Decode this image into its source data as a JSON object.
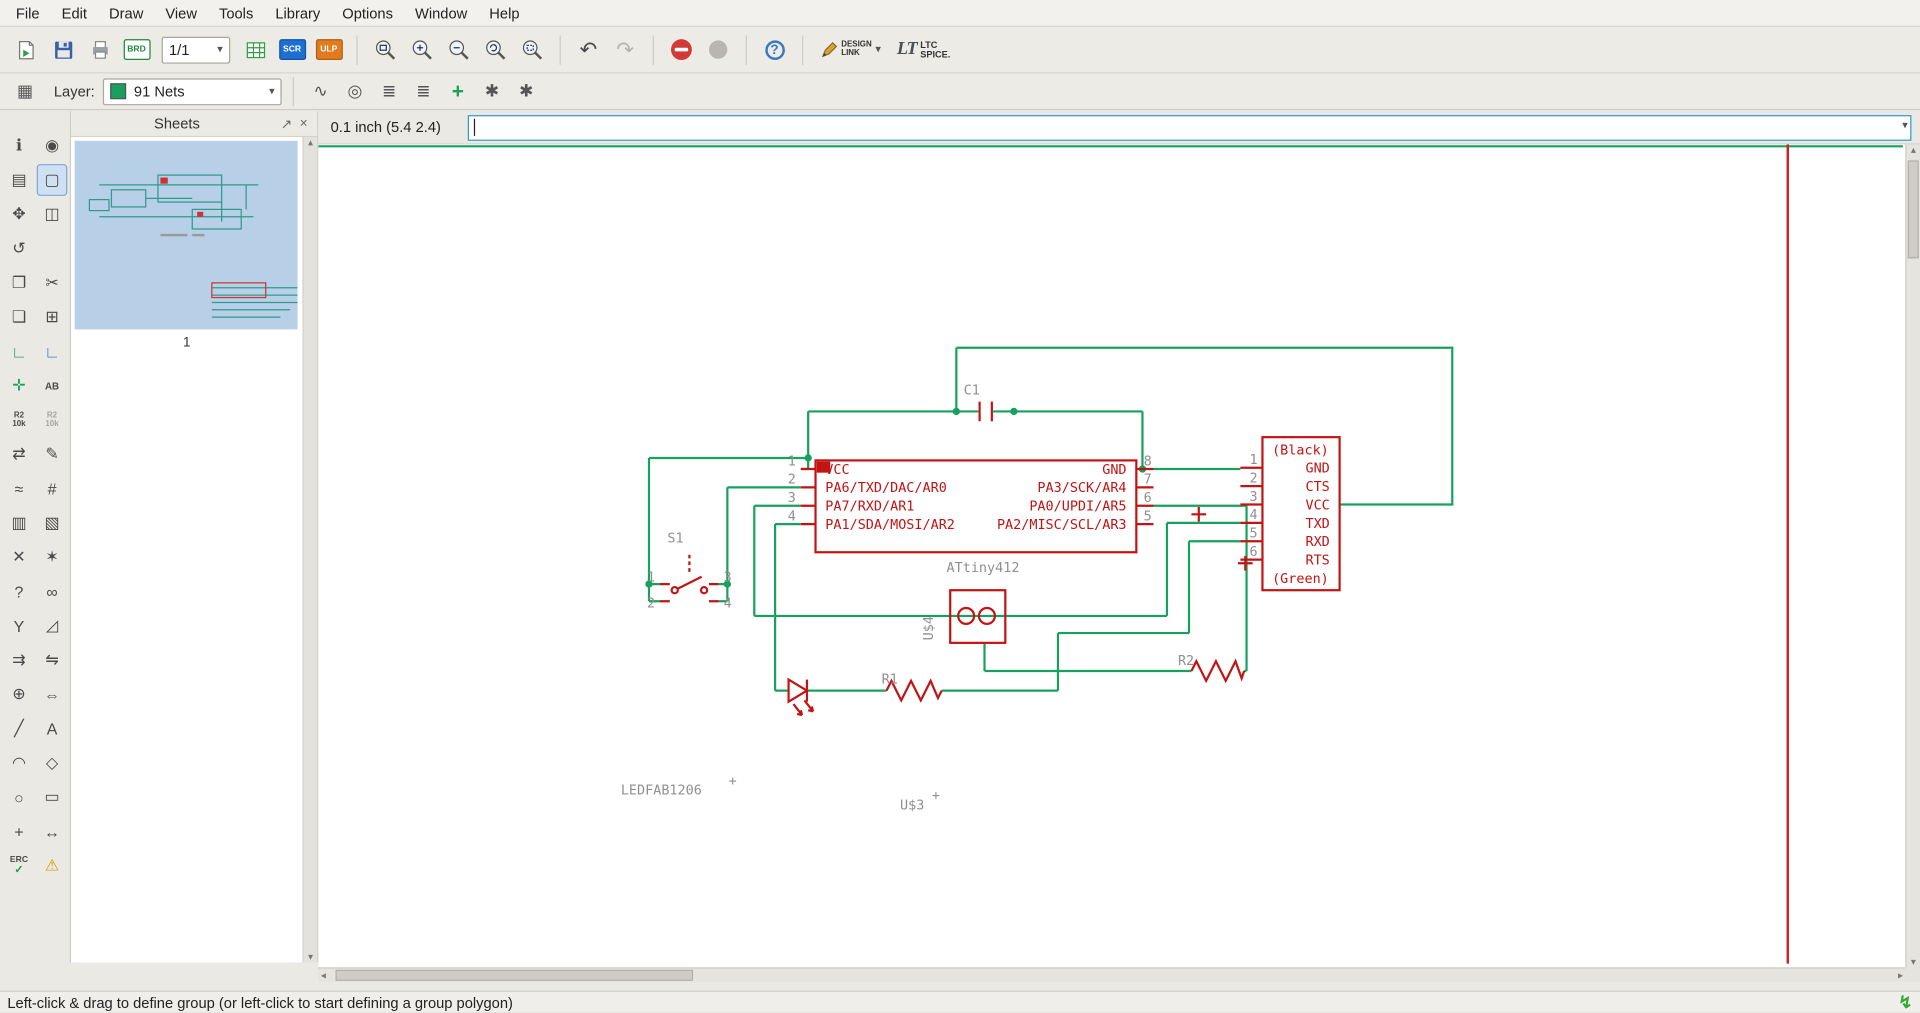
{
  "menubar": {
    "items": [
      "File",
      "Edit",
      "Draw",
      "View",
      "Tools",
      "Library",
      "Options",
      "Window",
      "Help"
    ]
  },
  "toolbar": {
    "page_indicator": "1/1",
    "brd_label": "BRD",
    "scr_label": "SCR",
    "ulp_label": "ULP",
    "design_link_line1": "DESIGN",
    "design_link_line2": "LINK",
    "ltc_logo": "LT",
    "ltc_line1": "LTC",
    "ltc_line2": "SPICE."
  },
  "layerbar": {
    "label": "Layer:",
    "selected_layer": "91 Nets",
    "swatch_color": "#19a05e"
  },
  "command_bar": {
    "coordinates": "0.1 inch (5.4 2.4)",
    "command_value": ""
  },
  "sheets_panel": {
    "title": "Sheets",
    "sheet_number": "1"
  },
  "palette": {
    "items": [
      {
        "name": "info-tool",
        "glyph": "ℹ"
      },
      {
        "name": "eye-tool",
        "glyph": "◉"
      },
      {
        "name": "display-layers-tool",
        "glyph": "▤"
      },
      {
        "name": "group-select-tool",
        "glyph": "▢",
        "active": true
      },
      {
        "name": "move-tool",
        "glyph": "✥"
      },
      {
        "name": "mirror-tool",
        "glyph": "◫"
      },
      {
        "name": "rotate-tool",
        "glyph": "↺"
      },
      {
        "name": "spacer",
        "empty": true
      },
      {
        "name": "copy-tool",
        "glyph": "❐"
      },
      {
        "name": "cut-tool",
        "glyph": "✂"
      },
      {
        "name": "paste-tool",
        "glyph": "❏"
      },
      {
        "name": "add-part-tool",
        "glyph": "⊞"
      },
      {
        "name": "net-tool",
        "glyph": "∟",
        "color": "#1ca05c"
      },
      {
        "name": "bus-tool",
        "glyph": "∟",
        "color": "#3a6fd8"
      },
      {
        "name": "junction-tool",
        "glyph": "✛",
        "color": "#1ca05c"
      },
      {
        "name": "label-tool",
        "glyph": "AB",
        "small": true
      },
      {
        "name": "attribute-tool",
        "glyph": "R2 10k",
        "twoline": true,
        "color": "#4a4a4a"
      },
      {
        "name": "global-attribute-tool",
        "glyph": "R2 10k",
        "twoline": true,
        "color": "#a8a5a0"
      },
      {
        "name": "pinswap-tool",
        "glyph": "⇄"
      },
      {
        "name": "change-tool",
        "glyph": "✎"
      },
      {
        "name": "smash-tool",
        "glyph": "≈"
      },
      {
        "name": "name-tool",
        "glyph": "#"
      },
      {
        "name": "copy-group-tool",
        "glyph": "▥"
      },
      {
        "name": "paste-group-tool",
        "glyph": "▧"
      },
      {
        "name": "delete-tool",
        "glyph": "✕"
      },
      {
        "name": "fixit-tool",
        "glyph": "✶"
      },
      {
        "name": "pin-info-tool",
        "glyph": "?"
      },
      {
        "name": "gateswap-tool",
        "glyph": "∞"
      },
      {
        "name": "split-tool",
        "glyph": "Y"
      },
      {
        "name": "miter-tool",
        "glyph": "◿"
      },
      {
        "name": "invoke-tool",
        "glyph": "⇉"
      },
      {
        "name": "replace-tool",
        "glyph": "⇋"
      },
      {
        "name": "mark-tool",
        "glyph": "⊕"
      },
      {
        "name": "dimension-tool",
        "glyph": "⇔"
      },
      {
        "name": "line-tool",
        "glyph": "╱"
      },
      {
        "name": "text-tool",
        "glyph": "A"
      },
      {
        "name": "arc-tool",
        "glyph": "◠"
      },
      {
        "name": "polygon-tool",
        "glyph": "◇"
      },
      {
        "name": "circle-tool",
        "glyph": "○"
      },
      {
        "name": "rect-tool",
        "glyph": "▭"
      },
      {
        "name": "origin-mark-tool",
        "glyph": "+"
      },
      {
        "name": "measure-tool",
        "glyph": "↔"
      },
      {
        "name": "erc-tool",
        "glyph": "ERC",
        "erc": true
      },
      {
        "name": "errors-tool",
        "glyph": "⚠",
        "color": "#d89a00"
      }
    ]
  },
  "schematic": {
    "colors": {
      "net": "#18a05e",
      "symbol": "#c31414",
      "label": "#909090"
    },
    "ic": {
      "name": "ATtiny412",
      "pins_left": [
        "VCC",
        "PA6/TXD/DAC/AR0",
        "PA7/RXD/AR1",
        "PA1/SDA/MOSI/AR2"
      ],
      "pins_right": [
        "GND",
        "PA3/SCK/AR4",
        "PA0/UPDI/AR5",
        "PA2/MISC/SCL/AR3"
      ],
      "pin_numbers_left": [
        "1",
        "2",
        "3",
        "4"
      ],
      "pin_numbers_right": [
        "8",
        "7",
        "6",
        "5"
      ]
    },
    "connector": {
      "top_label": "(Black)",
      "bottom_label": "(Green)",
      "pins": [
        "GND",
        "CTS",
        "VCC",
        "TXD",
        "RXD",
        "RTS"
      ],
      "pin_numbers": [
        "1",
        "2",
        "3",
        "4",
        "5",
        "6"
      ]
    },
    "components": {
      "capacitor": "C1",
      "switch": "S1",
      "resistor1": "R1",
      "resistor2": "R2",
      "updi_header": "U$4",
      "unplaced_label": "U$3",
      "led_footprint": "LEDFAB1206"
    },
    "switch_pin_numbers": [
      "1",
      "3",
      "2",
      "4"
    ],
    "superscript_mark": "+"
  },
  "statusbar": {
    "message": "Left-click & drag to define group (or left-click to start defining a group polygon)"
  }
}
